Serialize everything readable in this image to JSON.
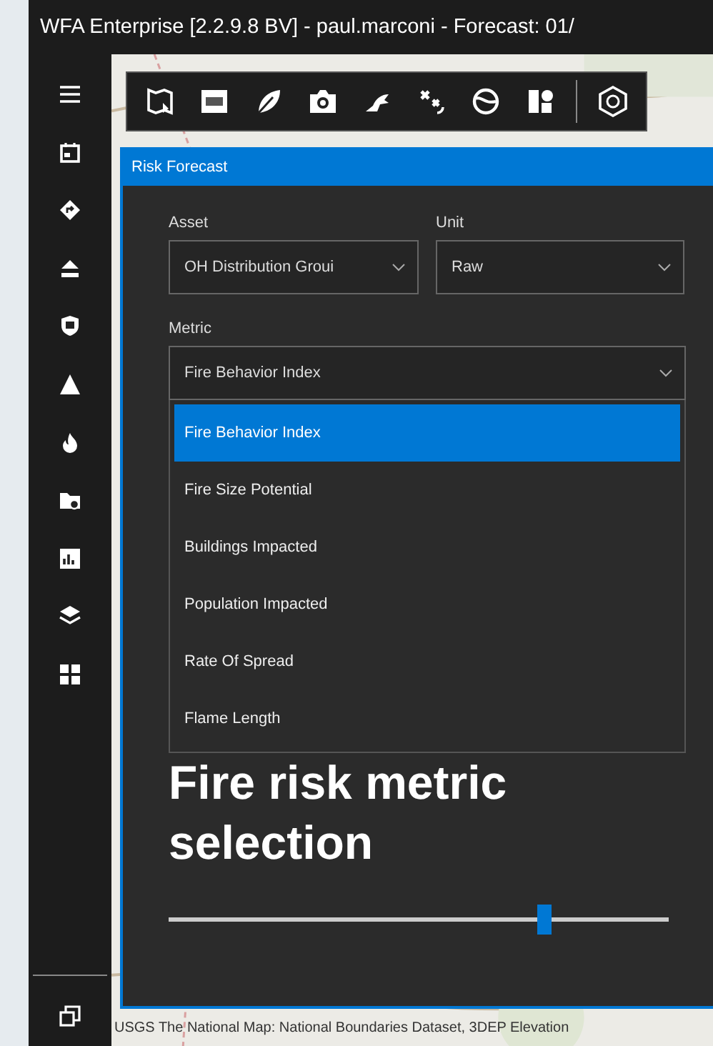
{
  "window": {
    "title": "WFA Enterprise [2.2.9.8 BV] - paul.marconi - Forecast: 01/"
  },
  "panel": {
    "title": "Risk Forecast",
    "fields": [
      {
        "label": "Asset",
        "value": "OH Distribution Groui"
      },
      {
        "label": "Unit",
        "value": "Raw"
      }
    ],
    "metric": {
      "label": "Metric",
      "value": "Fire Behavior Index",
      "expanded": true,
      "options": [
        {
          "label": "Fire Behavior Index",
          "selected": true
        },
        {
          "label": "Fire Size Potential",
          "selected": false
        },
        {
          "label": "Buildings Impacted",
          "selected": false
        },
        {
          "label": "Population Impacted",
          "selected": false
        },
        {
          "label": "Rate Of Spread",
          "selected": false
        },
        {
          "label": "Flame Length",
          "selected": false
        }
      ]
    },
    "slider": {
      "level": 0.75
    }
  },
  "caption": "Fire risk metric selection",
  "attribution": "USGS The National Map: National Boundaries Dataset, 3DEP Elevation"
}
